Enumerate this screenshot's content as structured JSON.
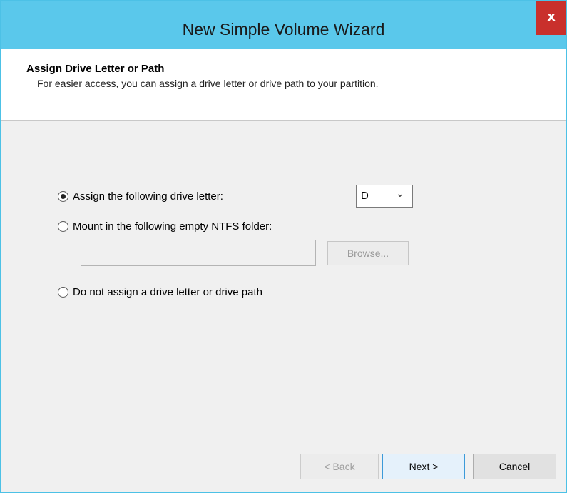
{
  "window": {
    "title": "New Simple Volume Wizard",
    "close_glyph": "x"
  },
  "header": {
    "title": "Assign Drive Letter or Path",
    "subtitle": "For easier access, you can assign a drive letter or drive path to your partition."
  },
  "options": {
    "assign_letter": {
      "label": "Assign the following drive letter:",
      "checked": true
    },
    "mount_folder": {
      "label": "Mount in the following empty NTFS folder:",
      "checked": false
    },
    "no_assign": {
      "label": "Do not assign a drive letter or drive path",
      "checked": false
    }
  },
  "drive_letter": {
    "selected": "D",
    "arrow_icon": "chevron-down-icon"
  },
  "folder_path": {
    "value": ""
  },
  "browse_label": "Browse...",
  "buttons": {
    "back": "< Back",
    "next": "Next >",
    "cancel": "Cancel"
  },
  "colors": {
    "titlebar": "#5ac8eb",
    "close": "#c9302c",
    "next_border": "#3c9ad9"
  }
}
